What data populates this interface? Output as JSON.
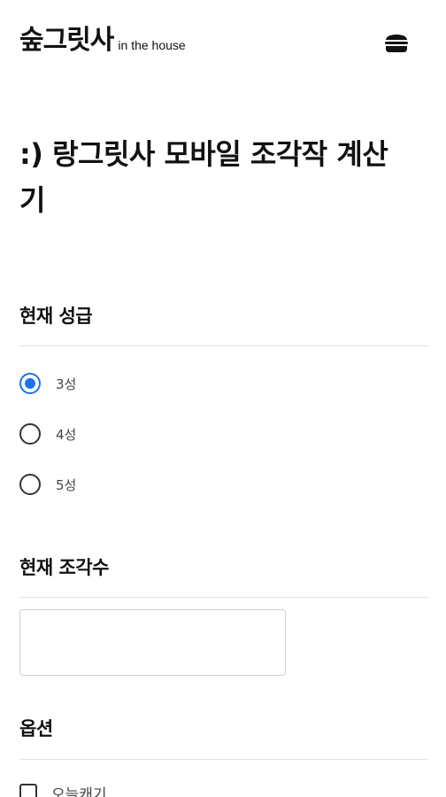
{
  "header": {
    "brand_main": "숲그릿사",
    "brand_sub": "in the house",
    "menu_icon": "hamburger-icon"
  },
  "page_title": ":) 랑그릿사 모바일 조각작 계산기",
  "sections": {
    "grade": {
      "heading": "현재 성급",
      "options": [
        "3성",
        "4성",
        "5성"
      ],
      "selected": "3성"
    },
    "pieces": {
      "heading": "현재 조각수",
      "input_value": "",
      "placeholder": ""
    },
    "options": {
      "heading": "옵션",
      "checkbox_label": "오늘캐기",
      "checked": false
    }
  },
  "colors": {
    "accent": "#1a73e8",
    "text": "#111111",
    "divider": "#e2e2e2"
  }
}
